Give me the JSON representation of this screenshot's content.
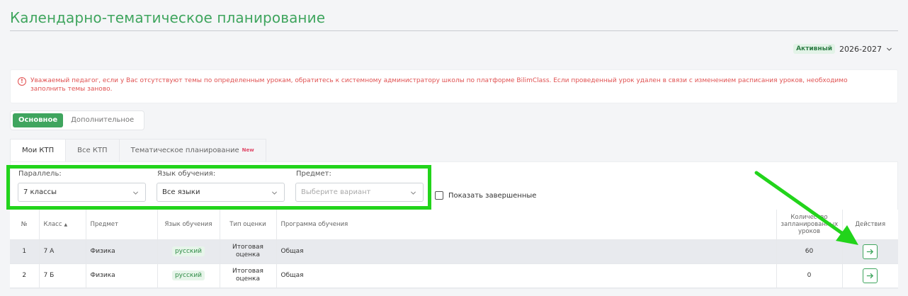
{
  "page": {
    "title": "Календарно-тематическое планирование"
  },
  "year": {
    "badge": "Активный",
    "value": "2026-2027"
  },
  "alert": {
    "text": "Уважаемый педагог, если у Вас отсутствуют темы по определенным урокам, обратитесь к системному администратору школы по платформе BilimClass. Если проведенный урок удален в связи с изменением расписания уроков, необходимо заполнить темы заново."
  },
  "segment": {
    "items": [
      "Основное",
      "Дополнительное"
    ],
    "selected": "Основное"
  },
  "tabs": {
    "items": [
      "Мои КТП",
      "Все КТП",
      "Тематическое планирование"
    ],
    "new_tag": "New",
    "selected": "Мои КТП"
  },
  "filters": {
    "parallel": {
      "label": "Параллель:",
      "value": "7 классы"
    },
    "language": {
      "label": "Язык обучения:",
      "value": "Все языки"
    },
    "subject": {
      "label": "Предмет:",
      "placeholder": "Выберите вариант"
    },
    "show_completed": {
      "label": "Показать завершенные",
      "checked": false
    }
  },
  "table": {
    "columns": [
      "№",
      "Класс",
      "Предмет",
      "Язык обучения",
      "Тип оценки",
      "Программа обучения",
      "Количество запланированных уроков",
      "Действия"
    ],
    "sort_indicator": "▲",
    "rows": [
      {
        "num": "1",
        "class": "7 А",
        "subject": "Физика",
        "language": "русский",
        "grade_type": "Итоговая оценка",
        "program": "Общая",
        "lessons": "60"
      },
      {
        "num": "2",
        "class": "7 Б",
        "subject": "Физика",
        "language": "русский",
        "grade_type": "Итоговая оценка",
        "program": "Общая",
        "lessons": "0"
      }
    ]
  },
  "colors": {
    "brand_green": "#3fa55e",
    "alert_red": "#e05252",
    "annotation_green": "#22d41b"
  },
  "icons": [
    "chevron-down-icon",
    "alert-circle-icon",
    "arrow-right-icon",
    "sort-asc-icon",
    "checkbox-icon"
  ]
}
